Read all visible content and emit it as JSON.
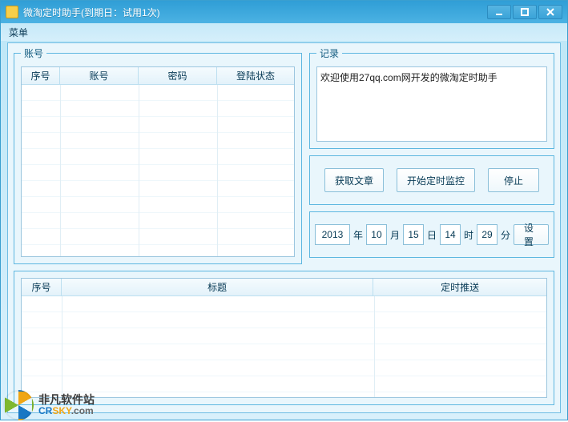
{
  "window": {
    "title": "微淘定时助手(到期日：试用1次)"
  },
  "menu": {
    "main_label": "菜单"
  },
  "accounts_group": {
    "legend": "账号",
    "columns": [
      "序号",
      "账号",
      "密码",
      "登陆状态"
    ]
  },
  "log_group": {
    "legend": "记录",
    "content": "欢迎使用27qq.com网开发的微淘定时助手"
  },
  "actions": {
    "fetch_label": "获取文章",
    "start_label": "开始定时监控",
    "stop_label": "停止"
  },
  "datetime": {
    "year": "2013",
    "year_suffix": "年",
    "month": "10",
    "month_suffix": "月",
    "day": "15",
    "day_suffix": "日",
    "hour": "14",
    "hour_suffix": "时",
    "minute": "29",
    "minute_suffix": "分",
    "set_label": "设置"
  },
  "bottom_group": {
    "columns": [
      "序号",
      "标题",
      "定时推送"
    ]
  },
  "watermark": {
    "line1": "非凡软件站",
    "brand_cr": "CR",
    "brand_sky": "SKY",
    "brand_com": ".com"
  }
}
